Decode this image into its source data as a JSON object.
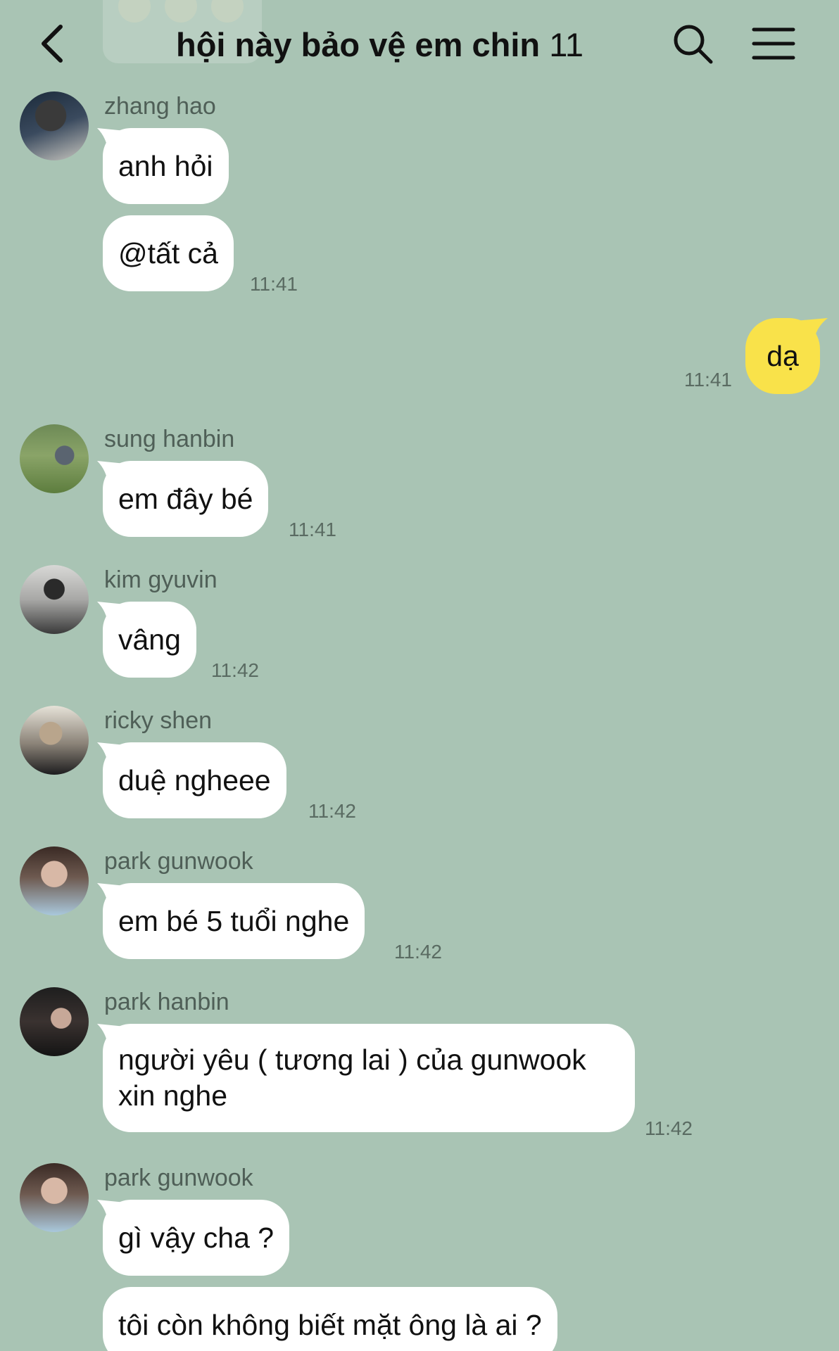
{
  "header": {
    "title": "hội này bảo vệ em chin",
    "member_count": "11",
    "back_icon": "chevron-left-icon",
    "search_icon": "search-icon",
    "menu_icon": "hamburger-menu-icon"
  },
  "colors": {
    "background": "#a9c4b4",
    "incoming_bubble": "#ffffff",
    "outgoing_bubble": "#f9e24a"
  },
  "messages": [
    {
      "sender": "zhang hao",
      "bubbles": [
        "anh hỏi",
        "@tất cả"
      ],
      "time": "11:41"
    },
    {
      "outgoing": true,
      "text": "dạ",
      "time": "11:41"
    },
    {
      "sender": "sung hanbin",
      "bubbles": [
        "em đây bé"
      ],
      "time": "11:41"
    },
    {
      "sender": "kim gyuvin",
      "bubbles": [
        "vâng"
      ],
      "time": "11:42"
    },
    {
      "sender": "ricky shen",
      "bubbles": [
        "duệ ngheee"
      ],
      "time": "11:42"
    },
    {
      "sender": "park gunwook",
      "bubbles": [
        "em bé 5 tuổi nghe"
      ],
      "time": "11:42"
    },
    {
      "sender": "park hanbin",
      "bubbles": [
        "người yêu ( tương lai ) của gunwook\nxin nghe"
      ],
      "time": "11:42"
    },
    {
      "sender": "park gunwook",
      "bubbles": [
        "gì vậy cha ?",
        "tôi còn không biết mặt ông là ai ?"
      ],
      "time": ""
    }
  ]
}
